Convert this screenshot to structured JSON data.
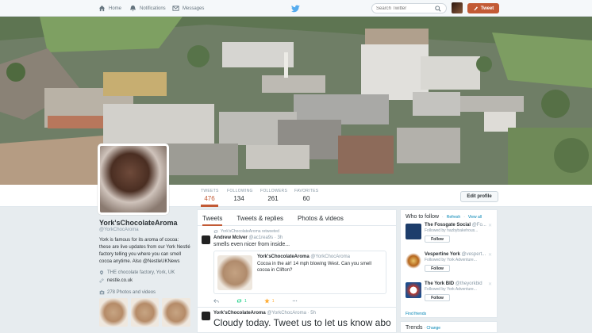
{
  "topnav": {
    "home_label": "Home",
    "notifications_label": "Notifications",
    "messages_label": "Messages",
    "search_placeholder": "Search Twitter",
    "tweet_label": "Tweet"
  },
  "stats": [
    {
      "label": "TWEETS",
      "value": "476"
    },
    {
      "label": "FOLLOWING",
      "value": "134"
    },
    {
      "label": "FOLLOWERS",
      "value": "261"
    },
    {
      "label": "FAVORITES",
      "value": "60"
    }
  ],
  "edit_profile_label": "Edit profile",
  "profile": {
    "name": "York'sChocolateAroma",
    "handle": "@YorkChocAroma",
    "bio": "York is famous for its aroma of cocoa: these are live updates from our York Nestlé factory telling you where you can smell cocoa anytime. Also @NestleUKNews",
    "location": "THE chocolate factory, York, UK",
    "website": "nestle.co.uk",
    "photos_label": "278 Photos and videos"
  },
  "tabs": {
    "tweets": "Tweets",
    "replies": "Tweets & replies",
    "photos": "Photos & videos"
  },
  "tweet1": {
    "retweeted_by": "York'sChocolateAroma retweeted",
    "author": "Andrew Mclver",
    "handle": "@ac1rea9s",
    "time": "3h",
    "text": "smells even nicer from inside...",
    "quote_author": "York'sChocolateAroma",
    "quote_handle": "@YorkChocAroma",
    "quote_text": "Cocoa in the air! 14 mph blowing West. Can you smell cocoa in Clifton?",
    "retweets": "1",
    "favorites": "1"
  },
  "tweet2": {
    "author": "York'sChocolateAroma",
    "handle": "@YorkChocAroma",
    "time": "5h",
    "text": "Cloudy today. Tweet us to let us know about"
  },
  "who_to_follow": {
    "title": "Who to follow",
    "refresh": "Refresh",
    "view_all": "View all",
    "follow_label": "Follow",
    "find_friends": "Find friends",
    "suggestions": [
      {
        "name": "The Fossgate Social",
        "handle": "@Fo...",
        "followed_by": "Followed by hazbybakehous..."
      },
      {
        "name": "Vespertine York",
        "handle": "@vespert...",
        "followed_by": "Followed by York Adventure..."
      },
      {
        "name": "The York BID",
        "handle": "@theyorkbid",
        "followed_by": "Followed by York Adventure..."
      }
    ]
  },
  "trends": {
    "title": "Trends",
    "change": "Change"
  },
  "colors": {
    "accent": "#c25a35",
    "link": "#0084b4"
  }
}
